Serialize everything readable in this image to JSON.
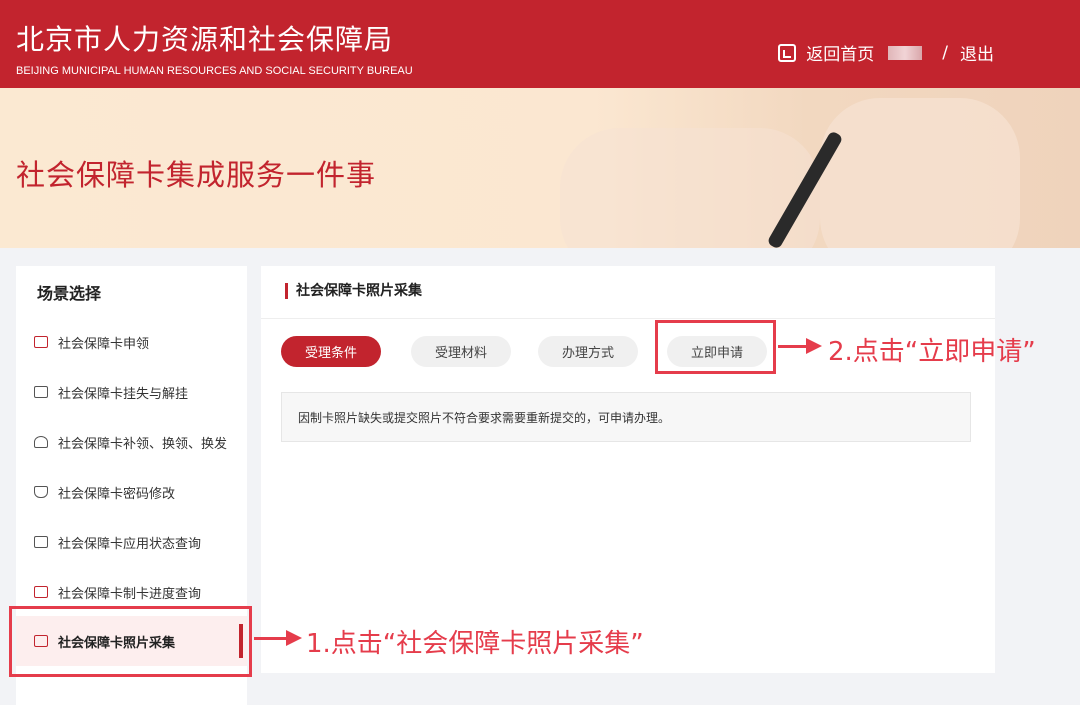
{
  "header": {
    "title": "北京市人力资源和社会保障局",
    "subtitle": "BEIJING MUNICIPAL HUMAN RESOURCES AND SOCIAL SECURITY BUREAU",
    "home_label": "返回首页",
    "separator": "/",
    "logout_label": "退出"
  },
  "banner": {
    "title": "社会保障卡集成服务一件事"
  },
  "sidebar": {
    "heading": "场景选择",
    "items": [
      {
        "label": "社会保障卡申领"
      },
      {
        "label": "社会保障卡挂失与解挂"
      },
      {
        "label": "社会保障卡补领、换领、换发"
      },
      {
        "label": "社会保障卡密码修改"
      },
      {
        "label": "社会保障卡应用状态查询"
      },
      {
        "label": "社会保障卡制卡进度查询"
      },
      {
        "label": "社会保障卡照片采集"
      }
    ]
  },
  "main": {
    "title": "社会保障卡照片采集",
    "tabs": [
      {
        "label": "受理条件"
      },
      {
        "label": "受理材料"
      },
      {
        "label": "办理方式"
      },
      {
        "label": "立即申请"
      }
    ],
    "info_text": "因制卡照片缺失或提交照片不符合要求需要重新提交的，可申请办理。"
  },
  "annotations": {
    "step1": "1.点击“社会保障卡照片采集”",
    "step2": "2.点击“立即申请”"
  },
  "colors": {
    "brand": "#c2242e",
    "annotation": "#e53c4b"
  }
}
